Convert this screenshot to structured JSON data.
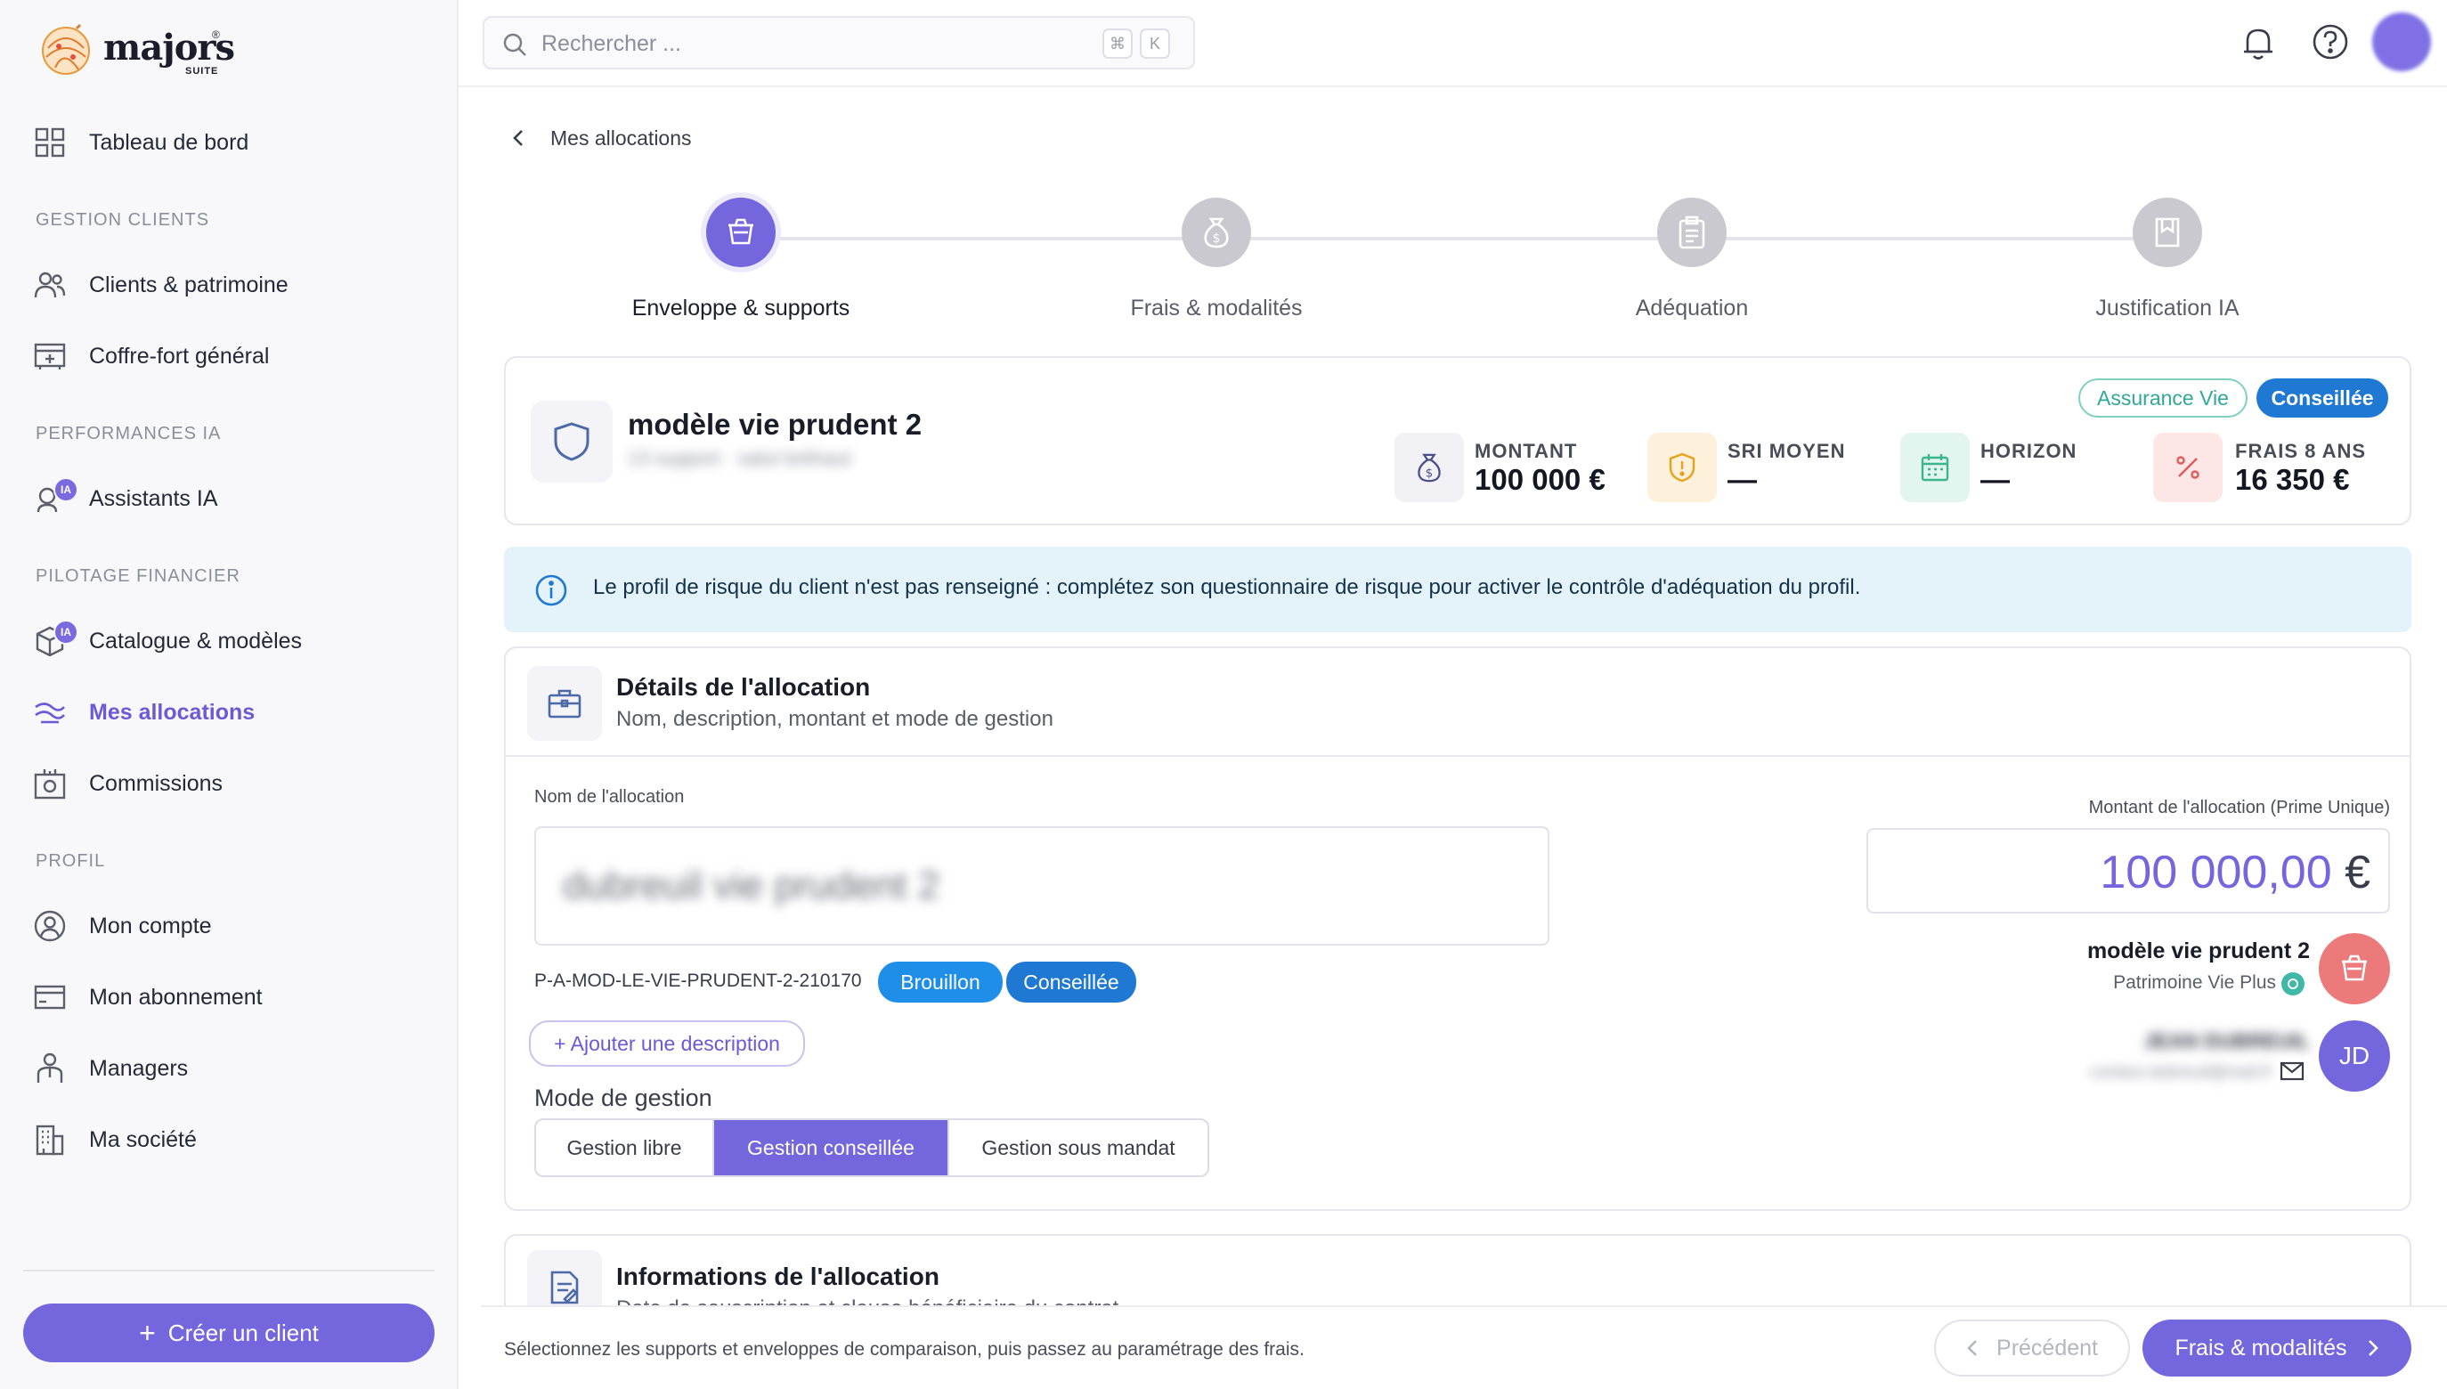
{
  "brand": {
    "name": "majors",
    "suffix": "SUITE",
    "reg": "®"
  },
  "sidebar": {
    "dashboard": "Tableau de bord",
    "sections": [
      {
        "title": "GESTION CLIENTS",
        "items": [
          "Clients & patrimoine",
          "Coffre-fort général"
        ]
      },
      {
        "title": "PERFORMANCES IA",
        "items": [
          "Assistants IA"
        ]
      },
      {
        "title": "PILOTAGE FINANCIER",
        "items": [
          "Catalogue & modèles",
          "Mes allocations",
          "Commissions"
        ]
      },
      {
        "title": "PROFIL",
        "items": [
          "Mon compte",
          "Mon abonnement",
          "Managers",
          "Ma société"
        ]
      }
    ],
    "ia_badge": "IA",
    "active_item": "Mes allocations",
    "create_label": "Créer un client"
  },
  "search": {
    "placeholder": "Rechercher ...",
    "kbd1": "⌘",
    "kbd2": "K"
  },
  "breadcrumb": "Mes allocations",
  "steps": [
    "Enveloppe & supports",
    "Frais & modalités",
    "Adéquation",
    "Justification IA"
  ],
  "summary": {
    "title": "modèle vie prudent 2",
    "subtitle_blurred": "13 support · salut bréhaut",
    "tags": [
      "Assurance Vie",
      "Conseillée"
    ],
    "kpis": [
      {
        "label": "MONTANT",
        "value": "100 000 €"
      },
      {
        "label": "SRI MOYEN",
        "value": "—"
      },
      {
        "label": "HORIZON",
        "value": "—"
      },
      {
        "label": "FRAIS 8 ANS",
        "value": "16 350 €"
      }
    ]
  },
  "info": "Le profil de risque du client n'est pas renseigné : complétez son questionnaire de risque pour activer le contrôle d'adéquation du profil.",
  "details": {
    "title": "Détails de l'allocation",
    "subtitle": "Nom, description, montant et mode de gestion",
    "name_label": "Nom de l'allocation",
    "name_value_blurred": "dubreuil vie prudent 2",
    "ref": "P-A-MOD-LE-VIE-PRUDENT-2-210170",
    "badges": [
      "Brouillon",
      "Conseillée"
    ],
    "add_description": "+ Ajouter une description",
    "mode_label": "Mode de gestion",
    "modes": [
      "Gestion libre",
      "Gestion conseillée",
      "Gestion sous mandat"
    ],
    "mode_selected": "Gestion conseillée",
    "amount_label": "Montant de l'allocation (Prime Unique)",
    "amount_value": "100 000,00",
    "amount_currency": "€",
    "model_name": "modèle vie prudent 2",
    "model_provider": "Patrimoine Vie Plus",
    "client_name_blurred": "JEAN DUBREUIL",
    "client_email_blurred": "contact.dubreuil@mail.fr",
    "client_initials": "JD"
  },
  "information": {
    "title": "Informations de l'allocation",
    "subtitle": "Date de souscription et clause bénéficiaire du contrat"
  },
  "footer": {
    "hint": "Sélectionnez les supports et enveloppes de comparaison, puis passez au paramétrage des frais.",
    "prev": "Précédent",
    "next": "Frais & modalités"
  },
  "colors": {
    "accent": "#7466dc",
    "blue": "#1f78d1",
    "teal": "#3fb8a8",
    "info_bg": "#e4f3fa"
  }
}
